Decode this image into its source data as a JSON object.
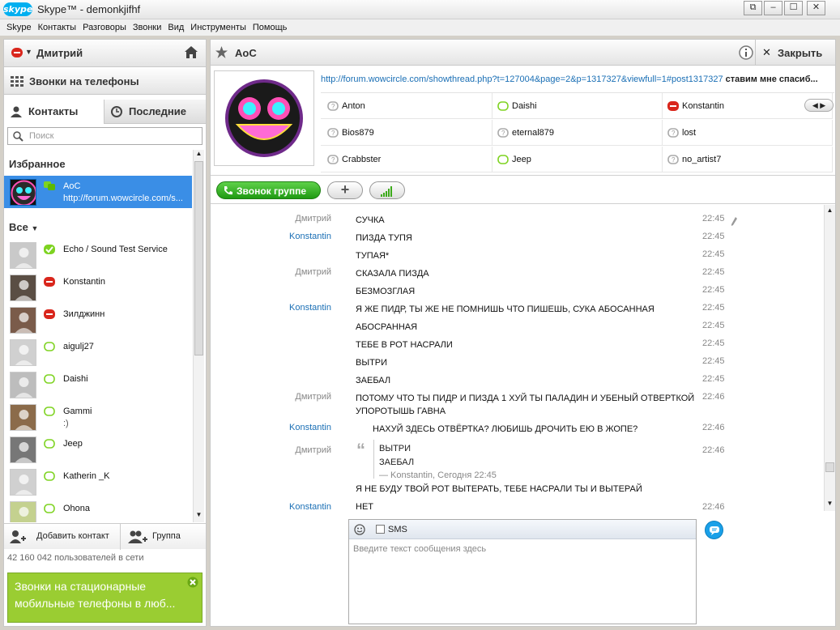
{
  "window": {
    "title": "Skype™ - demonkjifhf",
    "logo": "skype"
  },
  "menu": [
    "Skype",
    "Контакты",
    "Разговоры",
    "Звонки",
    "Вид",
    "Инструменты",
    "Помощь"
  ],
  "profile": {
    "name": "Дмитрий"
  },
  "phone_calls": "Звонки на телефоны",
  "tabs": {
    "contacts": "Контакты",
    "recent": "Последние"
  },
  "search": {
    "placeholder": "Поиск"
  },
  "favorites": {
    "label": "Избранное",
    "items": [
      {
        "name": "AoC",
        "sub": "http://forum.wowcircle.com/s..."
      }
    ]
  },
  "all_label": "Все",
  "contacts": [
    {
      "name": "Echo / Sound Test Service",
      "sub": "",
      "status": "online"
    },
    {
      "name": "Konstantin",
      "sub": "",
      "status": "busy"
    },
    {
      "name": "Зилджинн",
      "sub": "",
      "status": "busy"
    },
    {
      "name": "aigulj27",
      "sub": "",
      "status": "offline"
    },
    {
      "name": "Daishi",
      "sub": "",
      "status": "offline"
    },
    {
      "name": "Gammi",
      "sub": ":)",
      "status": "offline"
    },
    {
      "name": "Jeep",
      "sub": "",
      "status": "offline"
    },
    {
      "name": "Katherin _K",
      "sub": "",
      "status": "offline"
    },
    {
      "name": "Ohona",
      "sub": "",
      "status": "offline"
    }
  ],
  "bottom": {
    "add_contact": "Добавить контакт",
    "group": "Группа"
  },
  "online_count": "42 160 042 пользователей в сети",
  "promo": "Звонки на стационарные мобильные телефоны в люб...",
  "chat": {
    "title": "AoC",
    "close": "Закрыть",
    "mood_link": "http://forum.wowcircle.com/showthread.php?t=127004&page=2&p=1317327&viewfull=1#post1317327",
    "mood_text": "ставим мне спасиб...",
    "participants": [
      "Anton",
      "Daishi",
      "Konstantin",
      "Bios879",
      "eternal879",
      "lost",
      "Crabbster",
      "Jeep",
      "no_artist7"
    ],
    "call_group": "Звонок группе",
    "messages": [
      {
        "name": "Дмитрий",
        "text": "СУЧКА",
        "time": "22:45",
        "self": true
      },
      {
        "name": "Konstantin",
        "text": "ПИЗДА ТУПЯ",
        "time": "22:45",
        "self": false
      },
      {
        "name": "",
        "text": "ТУПАЯ*",
        "time": "22:45",
        "self": false
      },
      {
        "name": "Дмитрий",
        "text": "СКАЗАЛА ПИЗДА",
        "time": "22:45",
        "self": true
      },
      {
        "name": "",
        "text": "БЕЗМОЗГЛАЯ",
        "time": "22:45",
        "self": true
      },
      {
        "name": "Konstantin",
        "text": "Я ЖЕ ПИДР, ТЫ ЖЕ НЕ ПОМНИШЬ ЧТО ПИШЕШЬ, СУКА АБОСАННАЯ",
        "time": "22:45",
        "self": false
      },
      {
        "name": "",
        "text": "АБОСРАННАЯ",
        "time": "22:45",
        "self": false
      },
      {
        "name": "",
        "text": "ТЕБЕ В РОТ НАСРАЛИ",
        "time": "22:45",
        "self": false
      },
      {
        "name": "",
        "text": "ВЫТРИ",
        "time": "22:45",
        "self": false
      },
      {
        "name": "",
        "text": "ЗАЕБАЛ",
        "time": "22:45",
        "self": false
      },
      {
        "name": "Дмитрий",
        "text": "ПОТОМУ ЧТО ТЫ ПИДР И ПИЗДА 1 ХУЙ ТЫ ПАЛАДИН И УБЕНЫЙ ОТВЕРТКОЙ УПОРОТЫШЬ ГАВНА",
        "time": "22:46",
        "self": true
      },
      {
        "name": "Konstantin",
        "text": "НАХУЙ ЗДЕСЬ ОТВЁРТКА? ЛЮБИШЬ ДРОЧИТЬ ЕЮ В ЖОПЕ?",
        "time": "22:46",
        "self": false
      }
    ],
    "quote": {
      "name": "Дмитрий",
      "lines": [
        "ВЫТРИ",
        "ЗАЕБАЛ"
      ],
      "source": "— Konstantin, Сегодня 22:45",
      "after": "Я НЕ БУДУ ТВОЙ РОТ ВЫТЕРАТЬ, ТЕБЕ НАСРАЛИ ТЫ И ВЫТЕРАЙ",
      "time": "22:46"
    },
    "last": {
      "name": "Konstantin",
      "text": "НЕТ",
      "time": "22:46"
    },
    "sms_label": "SMS",
    "input_placeholder": "Введите текст сообщения здесь"
  },
  "colors": {
    "accent": "#3a8ee6",
    "link": "#1a6fb5",
    "green": "#1f9a12",
    "busy": "#d9261c"
  }
}
